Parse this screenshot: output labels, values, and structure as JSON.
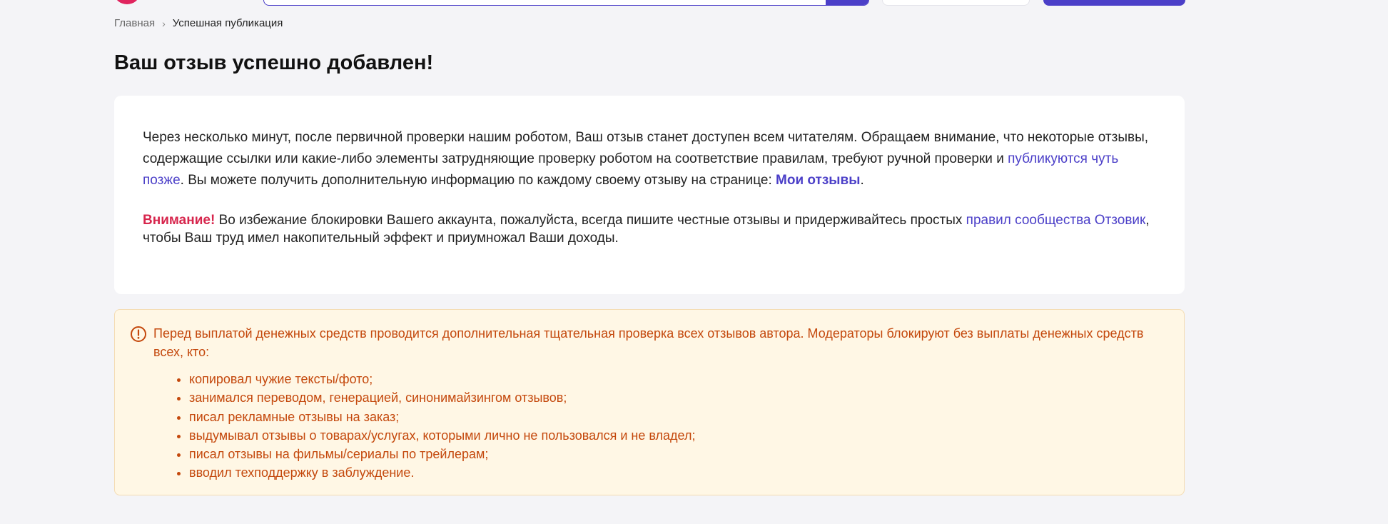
{
  "header": {
    "search": {
      "placeholder": ""
    }
  },
  "breadcrumb": {
    "home": "Главная",
    "separator": "›",
    "current": "Успешная публикация"
  },
  "page_title": "Ваш отзыв успешно добавлен!",
  "card": {
    "p1_part1": "Через несколько минут, после первичной проверки нашим роботом, Ваш отзыв станет доступен всем читателям. Обращаем внимание, что некоторые отзывы, содержащие ссылки или какие-либо элементы затрудняющие проверку роботом на соответствие правилам, требуют ручной проверки и ",
    "p1_link": "публикуются чуть позже",
    "p1_part2": ". Вы можете получить дополнительную информацию по каждому своему отзыву на странице: ",
    "my_reviews_link": "Мои отзывы",
    "p1_end": ".",
    "warn_label": "Внимание!",
    "warn_text1": " Во избежание блокировки Вашего аккаунта, пожалуйста, всегда пишите честные отзывы и придерживайтесь простых ",
    "rules_link": "правил сообщества Отзовик",
    "warn_text2": ", чтобы Ваш труд имел накопительный эффект и приумножал Ваши доходы."
  },
  "notice": {
    "text": "Перед выплатой денежных средств проводится дополнительная тщательная проверка всех отзывов автора. Модераторы блокируют без выплаты денежных средств всех, кто:",
    "items": [
      "копировал чужие тексты/фото;",
      "занимался переводом, генерацией, синонимайзингом отзывов;",
      "писал рекламные отзывы на заказ;",
      "выдумывал отзывы о товарах/услугах, которыми лично не пользовался и не владел;",
      "писал отзывы на фильмы/сериалы по трейлерам;",
      "вводил техподдержку в заблуждение."
    ]
  },
  "colors": {
    "accent": "#4b3fc8",
    "warning_red": "#d7264d",
    "notice_text": "#c4480c",
    "notice_bg": "#fff7e5"
  },
  "icons": {
    "notice": "exclamation-circle-icon",
    "search": "search-icon"
  }
}
